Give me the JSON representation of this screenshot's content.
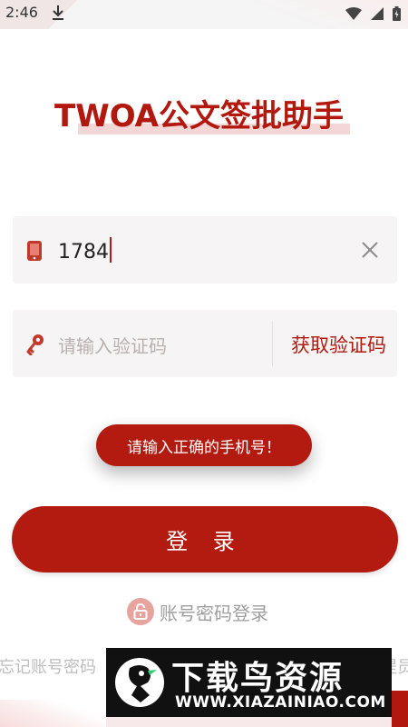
{
  "status_bar": {
    "time": "2:46",
    "icons": [
      "download-icon",
      "wifi-icon",
      "signal-icon",
      "battery-icon"
    ]
  },
  "app": {
    "title": "TWOA公文签批助手"
  },
  "form": {
    "phone": {
      "value": "1784",
      "icon": "phone-icon",
      "clear_icon": "close-icon"
    },
    "code": {
      "placeholder": "请输入验证码",
      "icon": "key-icon",
      "get_code_label": "获取验证码"
    },
    "login_label": "登 录",
    "account_login_label": "账号密码登录",
    "account_login_icon": "lock-icon"
  },
  "toast": {
    "message": "请输入正确的手机号！"
  },
  "footer": {
    "forgot_label": "忘记账号密码",
    "policy_label": "提员"
  },
  "watermark": {
    "text": "下载鸟资源",
    "url": "WWW.XIAZAINIAO.COM"
  },
  "colors": {
    "accent": "#b41b10",
    "input_bg": "#f6f4f4",
    "placeholder": "#b8b0b0"
  }
}
